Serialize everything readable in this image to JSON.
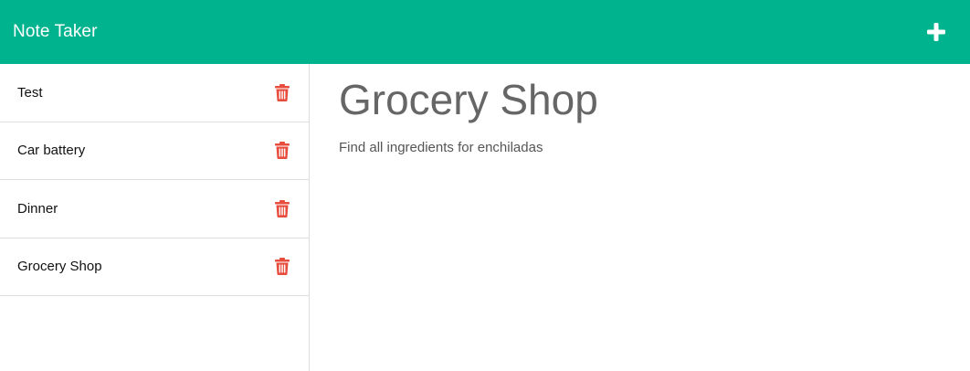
{
  "app": {
    "title": "Note Taker"
  },
  "toolbar": {
    "new_note_icon": "plus-icon"
  },
  "notes": [
    {
      "title": "Test",
      "delete_icon": "trash-icon"
    },
    {
      "title": "Car battery",
      "delete_icon": "trash-icon"
    },
    {
      "title": "Dinner",
      "delete_icon": "trash-icon"
    },
    {
      "title": "Grocery Shop",
      "delete_icon": "trash-icon"
    }
  ],
  "active_note": {
    "title": "Grocery Shop",
    "text": "Find all ingredients for enchiladas"
  },
  "colors": {
    "navbar": "#00b38f",
    "delete": "#e74c3c",
    "heading": "#666666"
  }
}
